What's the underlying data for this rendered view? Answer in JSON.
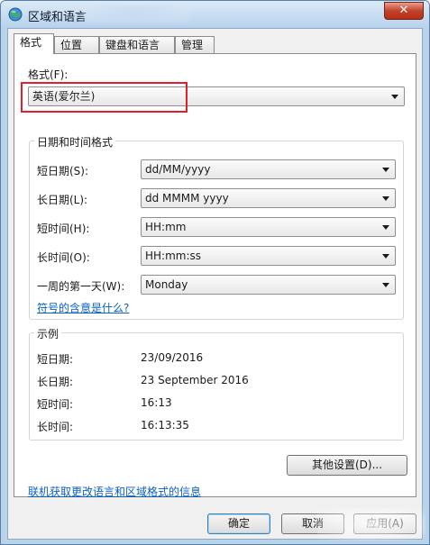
{
  "window": {
    "title": "区域和语言",
    "close_label": "✕"
  },
  "tabs": [
    {
      "label": "格式"
    },
    {
      "label": "位置"
    },
    {
      "label": "键盘和语言"
    },
    {
      "label": "管理"
    }
  ],
  "format": {
    "label": "格式(F):",
    "value": "英语(爱尔兰)"
  },
  "datetime_group": {
    "title": "日期和时间格式",
    "rows": [
      {
        "label": "短日期(S):",
        "value": "dd/MM/yyyy"
      },
      {
        "label": "长日期(L):",
        "value": "dd MMMM yyyy"
      },
      {
        "label": "短时间(H):",
        "value": "HH:mm"
      },
      {
        "label": "长时间(O):",
        "value": "HH:mm:ss"
      },
      {
        "label": "一周的第一天(W):",
        "value": "Monday"
      }
    ],
    "symbol_link": "符号的含意是什么?"
  },
  "example_group": {
    "title": "示例",
    "rows": [
      {
        "label": "短日期:",
        "value": "23/09/2016"
      },
      {
        "label": "长日期:",
        "value": "23 September 2016"
      },
      {
        "label": "短时间:",
        "value": "16:13"
      },
      {
        "label": "长时间:",
        "value": "16:13:35"
      }
    ]
  },
  "other_settings_button": "其他设置(D)...",
  "online_link": "联机获取更改语言和区域格式的信息",
  "footer": {
    "ok": "确定",
    "cancel": "取消",
    "apply": "应用(A)"
  }
}
